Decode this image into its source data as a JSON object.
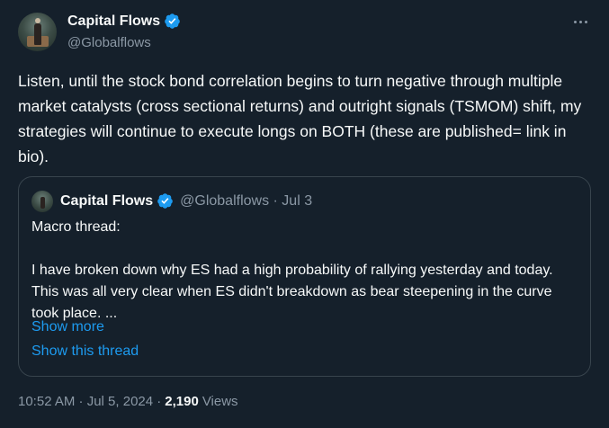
{
  "author": {
    "display_name": "Capital Flows",
    "handle": "@Globalflows",
    "avatar_icon": "portrait-avatar",
    "verified_icon": "verified-badge-icon"
  },
  "tweet": {
    "text": "Listen, until the stock bond correlation begins to turn negative through multiple market catalysts (cross sectional returns) and outright signals (TSMOM) shift, my strategies will continue to execute longs on BOTH (these are published= link in bio).",
    "more_icon": "more-options-icon"
  },
  "quote": {
    "display_name": "Capital Flows",
    "handle_date": "@Globalflows · Jul 3",
    "text": "Macro thread:\n\nI have broken down why ES had a high probability of rallying yesterday and today. This was all very clear when ES didn't breakdown as bear steepening in the curve took place. ...",
    "show_more": "Show more",
    "show_thread": "Show this thread"
  },
  "meta": {
    "timestamp": "10:52 AM · Jul 5, 2024 ·",
    "views_count": "2,190",
    "views_label": "Views"
  },
  "colors": {
    "background": "#15202b",
    "accent": "#1d9bf0",
    "secondary_text": "#8b98a5",
    "border": "#38444d"
  }
}
